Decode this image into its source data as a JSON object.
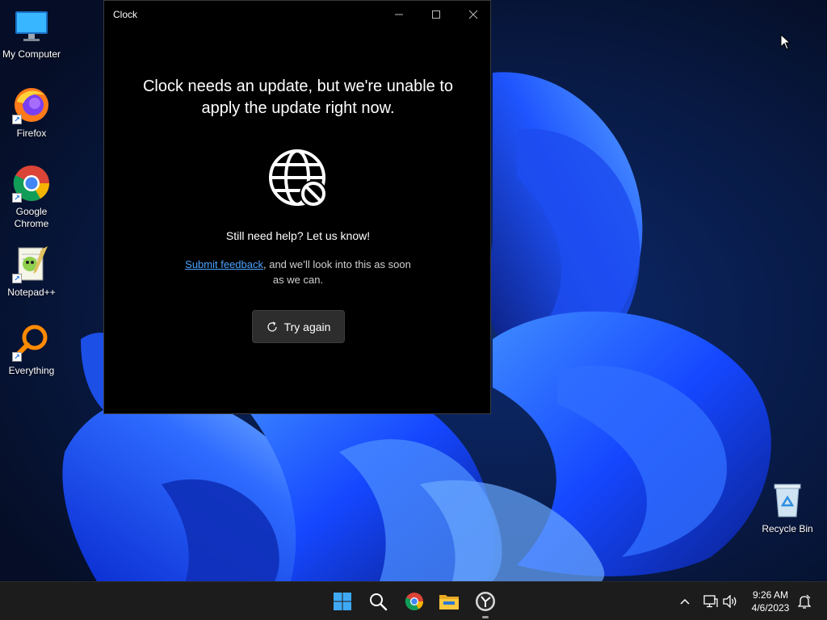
{
  "desktop": {
    "icons": [
      {
        "label": "My Computer",
        "icon": "monitor-icon"
      },
      {
        "label": "Firefox",
        "icon": "firefox-icon"
      },
      {
        "label": "Google Chrome",
        "icon": "chrome-icon"
      },
      {
        "label": "Notepad++",
        "icon": "notepadpp-icon"
      },
      {
        "label": "Everything",
        "icon": "everything-search-icon"
      },
      {
        "label": "Recycle Bin",
        "icon": "recycle-bin-icon"
      }
    ]
  },
  "window": {
    "title": "Clock",
    "headline": "Clock needs an update, but we're unable to apply the update right now.",
    "help_text": "Still need help? Let us know!",
    "feedback_link": "Submit feedback",
    "feedback_rest": ", and we’ll look into this as soon as we can.",
    "try_again_label": "Try again",
    "icon": "globe-blocked-icon"
  },
  "taskbar": {
    "apps": [
      "start-icon",
      "search-icon",
      "chrome-icon",
      "file-explorer-icon",
      "clock-app-icon"
    ],
    "active_app": "clock-app-icon",
    "time": "9:26 AM",
    "date": "4/6/2023"
  },
  "colors": {
    "window_bg": "#000000",
    "link": "#4aa3ff",
    "button_bg": "#2d2d2d",
    "taskbar_bg": "#1c1c1c",
    "wallpaper_accent": "#1a4dff"
  }
}
